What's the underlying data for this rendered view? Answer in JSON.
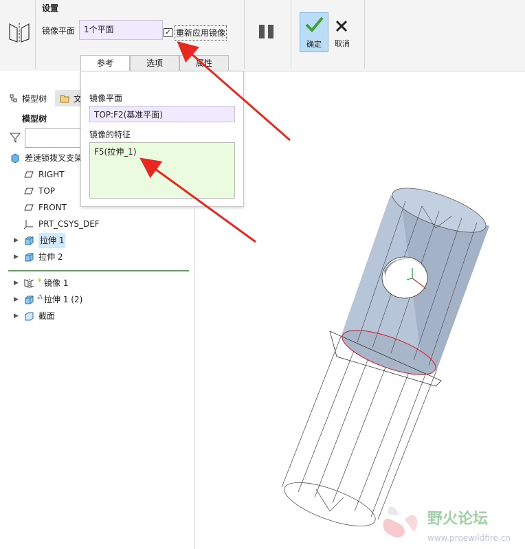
{
  "ribbon": {
    "settings_title": "设置",
    "mirror_plane_label": "镜像平面",
    "mirror_plane_value": "1个平面",
    "reapply_label": "重新应用镜像",
    "reapply_checked": true,
    "ok_label": "确定",
    "cancel_label": "取消",
    "tabs": [
      {
        "label": "参考",
        "active": true
      },
      {
        "label": "选项",
        "active": false
      },
      {
        "label": "属性",
        "active": false
      }
    ]
  },
  "popup": {
    "plane_label": "镜像平面",
    "plane_value": "TOP:F2(基准平面)",
    "features_label": "镜像的特征",
    "features_value": "F5(拉伸_1)"
  },
  "left": {
    "tabs": {
      "model_tree": "模型树",
      "files": "文"
    },
    "model_tree_title": "模型树",
    "part_name": "差速锁拨叉支架",
    "items": [
      {
        "label": "RIGHT",
        "icon": "datum-plane-icon"
      },
      {
        "label": "TOP",
        "icon": "datum-plane-icon"
      },
      {
        "label": "FRONT",
        "icon": "datum-plane-icon"
      },
      {
        "label": "PRT_CSYS_DEF",
        "icon": "csys-icon"
      },
      {
        "label": "拉伸 1",
        "icon": "extrude-icon",
        "expandable": true,
        "highlighted": true
      },
      {
        "label": "拉伸 2",
        "icon": "extrude-icon",
        "expandable": true
      }
    ],
    "items_after": [
      {
        "label": "镜像 1",
        "icon": "mirror-icon",
        "expandable": true
      },
      {
        "label": "拉伸 1 (2)",
        "icon": "extrude-icon",
        "expandable": true
      },
      {
        "label": "截面",
        "icon": "section-icon",
        "expandable": true
      }
    ]
  },
  "colors": {
    "accent": "#2a9ad8",
    "arrow": "#e8281f",
    "field": "#f0eaff",
    "features_field": "#eafbe0",
    "divider": "#4caf50",
    "cylinder": "#b7c5d8"
  },
  "watermark": {
    "title": "野火论坛",
    "url": "www.proewildfire.cn"
  }
}
